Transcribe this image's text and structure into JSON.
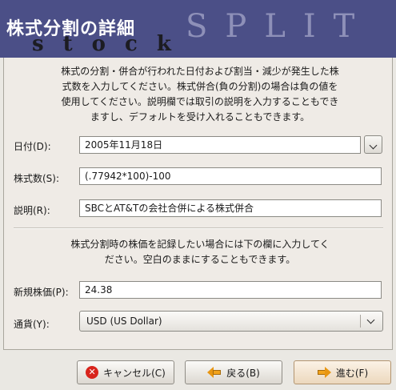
{
  "window": {
    "title": "株式分割の詳細",
    "logo_word_stock": "stock",
    "logo_word_split": "SPLIT"
  },
  "intro_text": "株式の分割・併合が行われた日付および割当・減少が発生した株式数を入力してください。株式併合(負の分割)の場合は負の値を使用してください。説明欄では取引の説明を入力することもできますし、デフォルトを受け入れることもできます。",
  "intro_lines": [
    "株式の分割・併合が行われた日付および割当・減少が発生した株",
    "式数を入力してください。株式併合(負の分割)の場合は負の値を",
    "使用してください。説明欄では取引の説明を入力することもでき",
    "ますし、デフォルトを受け入れることもできます。"
  ],
  "fields": {
    "date": {
      "label": "日付(D):",
      "value": "2005年11月18日"
    },
    "shares": {
      "label": "株式数(S):",
      "value": "(.77942*100)-100"
    },
    "description": {
      "label": "説明(R):",
      "value": "SBCとAT&Tの会社合併による株式併合"
    }
  },
  "price_intro_lines": [
    "株式分割時の株価を記録したい場合には下の欄に入力してく",
    "ださい。空白のままにすることもできます。"
  ],
  "price": {
    "label": "新規株価(P):",
    "value": "24.38"
  },
  "currency": {
    "label": "通貨(Y):",
    "value": "USD (US Dollar)"
  },
  "buttons": {
    "cancel": "キャンセル(C)",
    "back": "戻る(B)",
    "next": "進む(F)"
  },
  "colors": {
    "banner": "#4b4f87",
    "background": "#eae8e3"
  }
}
